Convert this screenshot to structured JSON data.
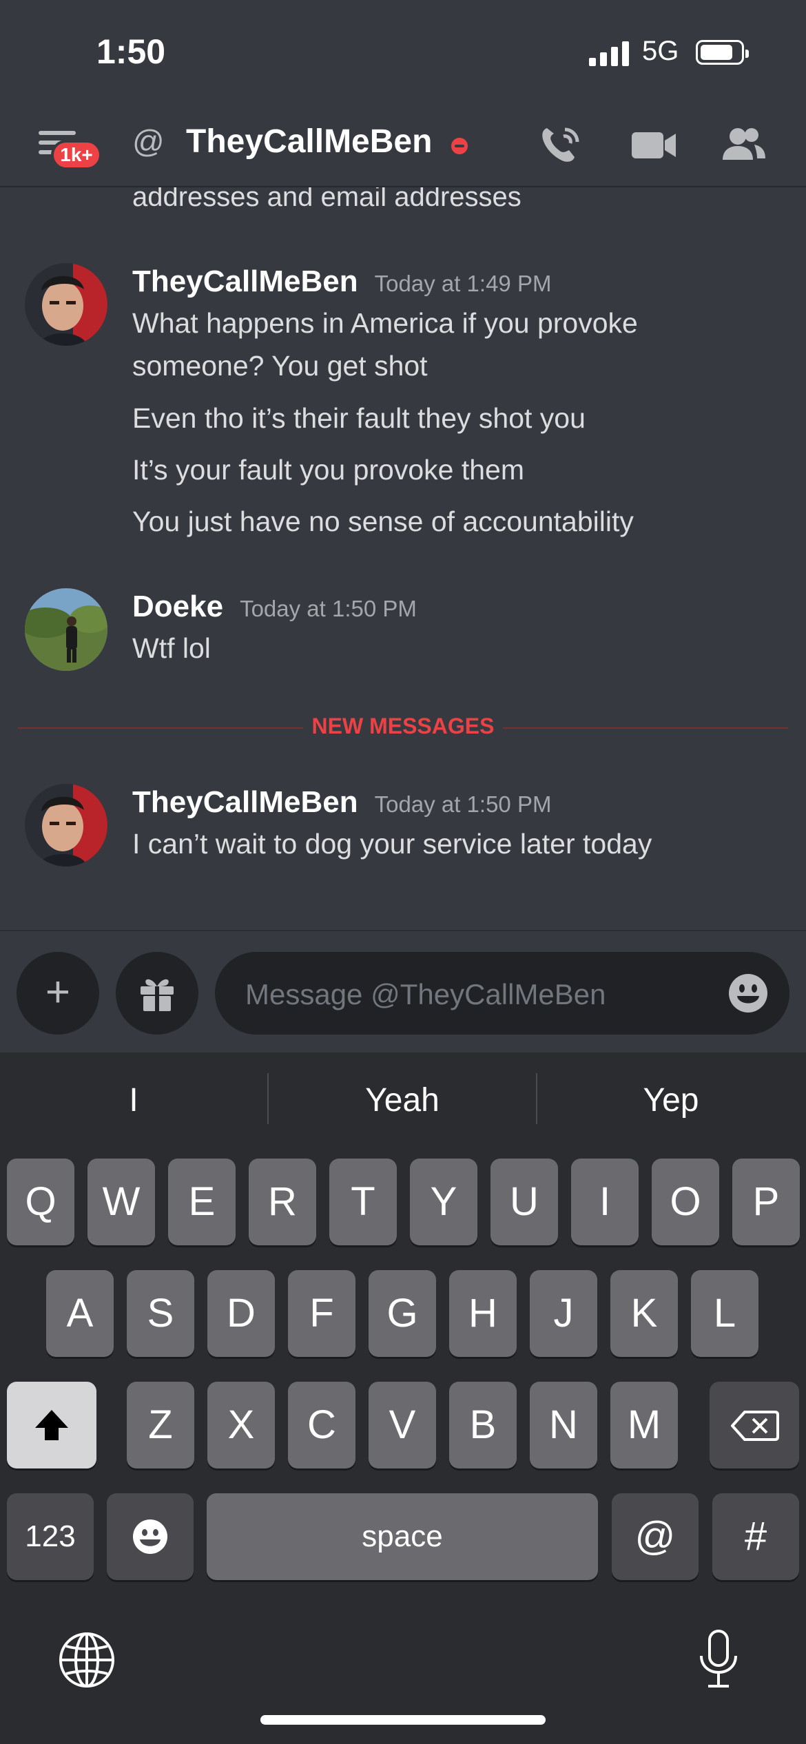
{
  "status": {
    "time": "1:50",
    "network": "5G"
  },
  "header": {
    "badge": "1k+",
    "title": "TheyCallMeBen"
  },
  "chat": {
    "cut_text": "addresses and email addresses",
    "messages": [
      {
        "author": "TheyCallMeBen",
        "timestamp": "Today at 1:49 PM",
        "lines": [
          "What happens in America if you provoke",
          "someone? You get shot",
          "Even tho it’s their fault they shot you",
          "It’s your fault you provoke them",
          "You just have no sense of accountability"
        ]
      },
      {
        "author": "Doeke",
        "timestamp": "Today at 1:50 PM",
        "lines": [
          "Wtf lol"
        ]
      },
      {
        "author": "TheyCallMeBen",
        "timestamp": "Today at 1:50 PM",
        "lines": [
          "I can’t wait to dog your service later today"
        ]
      }
    ],
    "new_messages_label": "NEW MESSAGES"
  },
  "composer": {
    "placeholder": "Message @TheyCallMeBen"
  },
  "keyboard": {
    "suggestions": [
      "I",
      "Yeah",
      "Yep"
    ],
    "row1": [
      "Q",
      "W",
      "E",
      "R",
      "T",
      "Y",
      "U",
      "I",
      "O",
      "P"
    ],
    "row2": [
      "A",
      "S",
      "D",
      "F",
      "G",
      "H",
      "J",
      "K",
      "L"
    ],
    "row3": [
      "Z",
      "X",
      "C",
      "V",
      "B",
      "N",
      "M"
    ],
    "numbers_key": "123",
    "space_key": "space",
    "at_key": "@",
    "hash_key": "#"
  },
  "colors": {
    "background": "#36393f",
    "accent_red": "#ed4245",
    "input_bg": "#202225"
  },
  "icons": [
    "menu-icon",
    "at-icon",
    "phone-call-icon",
    "video-camera-icon",
    "members-icon",
    "plus-icon",
    "gift-icon",
    "emoji-icon",
    "shift-icon",
    "backspace-icon",
    "globe-icon",
    "microphone-icon"
  ]
}
